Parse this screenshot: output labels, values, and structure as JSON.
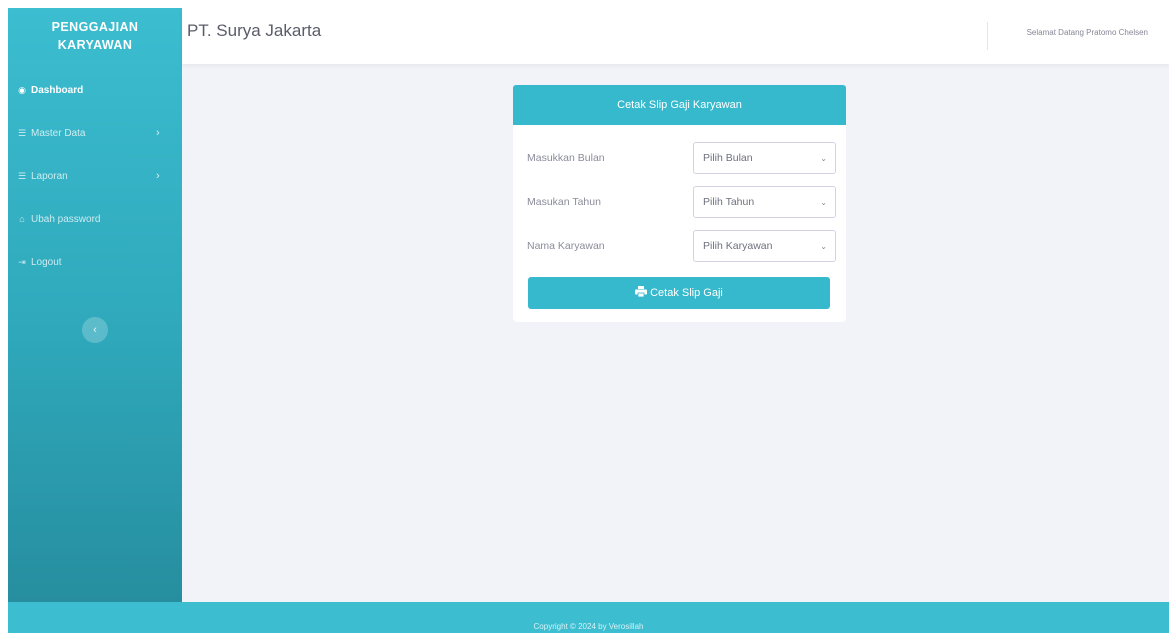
{
  "sidebar": {
    "brand_line1": "PENGGAJIAN",
    "brand_line2": "KARYAWAN",
    "items": [
      {
        "label": "Dashboard",
        "icon": "gauge-icon",
        "glyph": "◉",
        "active": true,
        "has_submenu": false
      },
      {
        "label": "Master Data",
        "icon": "database-icon",
        "glyph": "☰",
        "active": false,
        "has_submenu": true
      },
      {
        "label": "Laporan",
        "icon": "report-icon",
        "glyph": "☰",
        "active": false,
        "has_submenu": true
      },
      {
        "label": "Ubah password",
        "icon": "lock-icon",
        "glyph": "⌂",
        "active": false,
        "has_submenu": false
      },
      {
        "label": "Logout",
        "icon": "logout-icon",
        "glyph": "⇥",
        "active": false,
        "has_submenu": false
      }
    ],
    "toggle_glyph": "‹"
  },
  "topbar": {
    "company": "PT. Surya Jakarta",
    "greeting": "Selamat Datang Pratomo Chelsen"
  },
  "card": {
    "title": "Cetak Slip Gaji Karyawan",
    "fields": [
      {
        "label": "Masukkan Bulan",
        "selected": "Pilih Bulan"
      },
      {
        "label": "Masukan Tahun",
        "selected": "Pilih Tahun"
      },
      {
        "label": "Nama Karyawan",
        "selected": "Pilih Karyawan"
      }
    ],
    "button_label": "Cetak Slip Gaji"
  },
  "footer": {
    "text": "Copyright © 2024 by Verosillah"
  },
  "colors": {
    "accent": "#36b9cc",
    "sidebar_top": "#3cbdd0",
    "sidebar_bottom": "#268e9f",
    "background": "#f1f3f9"
  }
}
